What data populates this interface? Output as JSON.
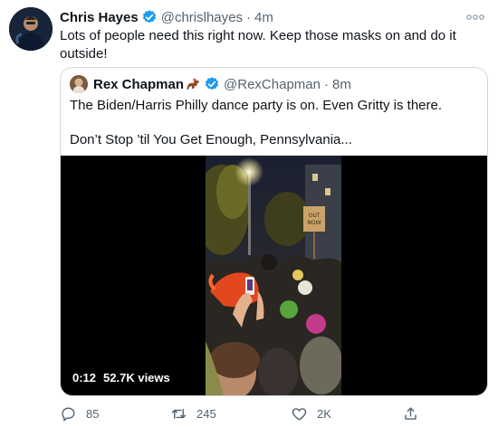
{
  "tweet": {
    "author_name": "Chris Hayes",
    "handle": "@chrislhayes",
    "separator": "·",
    "time": "4m",
    "text": "Lots of people need this right now. Keep those masks on and do it outside!",
    "verified": true
  },
  "quoted_tweet": {
    "author_name": "Rex Chapman",
    "author_emoji": "horse-racing-icon",
    "handle": "@RexChapman",
    "separator": "·",
    "time": "8m",
    "text_line1": "The Biden/Harris Philly dance party is on. Even Gritty is there.",
    "text_line2": "Don’t Stop ’til You Get Enough, Pennsylvania...",
    "verified": true
  },
  "video": {
    "duration": "0:12",
    "views": "52.7K views",
    "sign_text": "OUT NOW"
  },
  "actions": {
    "reply_count": "85",
    "retweet_count": "245",
    "like_count": "2K"
  },
  "colors": {
    "verified": "#1d9bf0",
    "text": "#0f1419",
    "secondary": "#536471",
    "border": "#cfd9de"
  },
  "icons": [
    "more-icon",
    "verified-icon",
    "horse-racing-icon",
    "reply-icon",
    "retweet-icon",
    "like-icon",
    "share-icon"
  ]
}
